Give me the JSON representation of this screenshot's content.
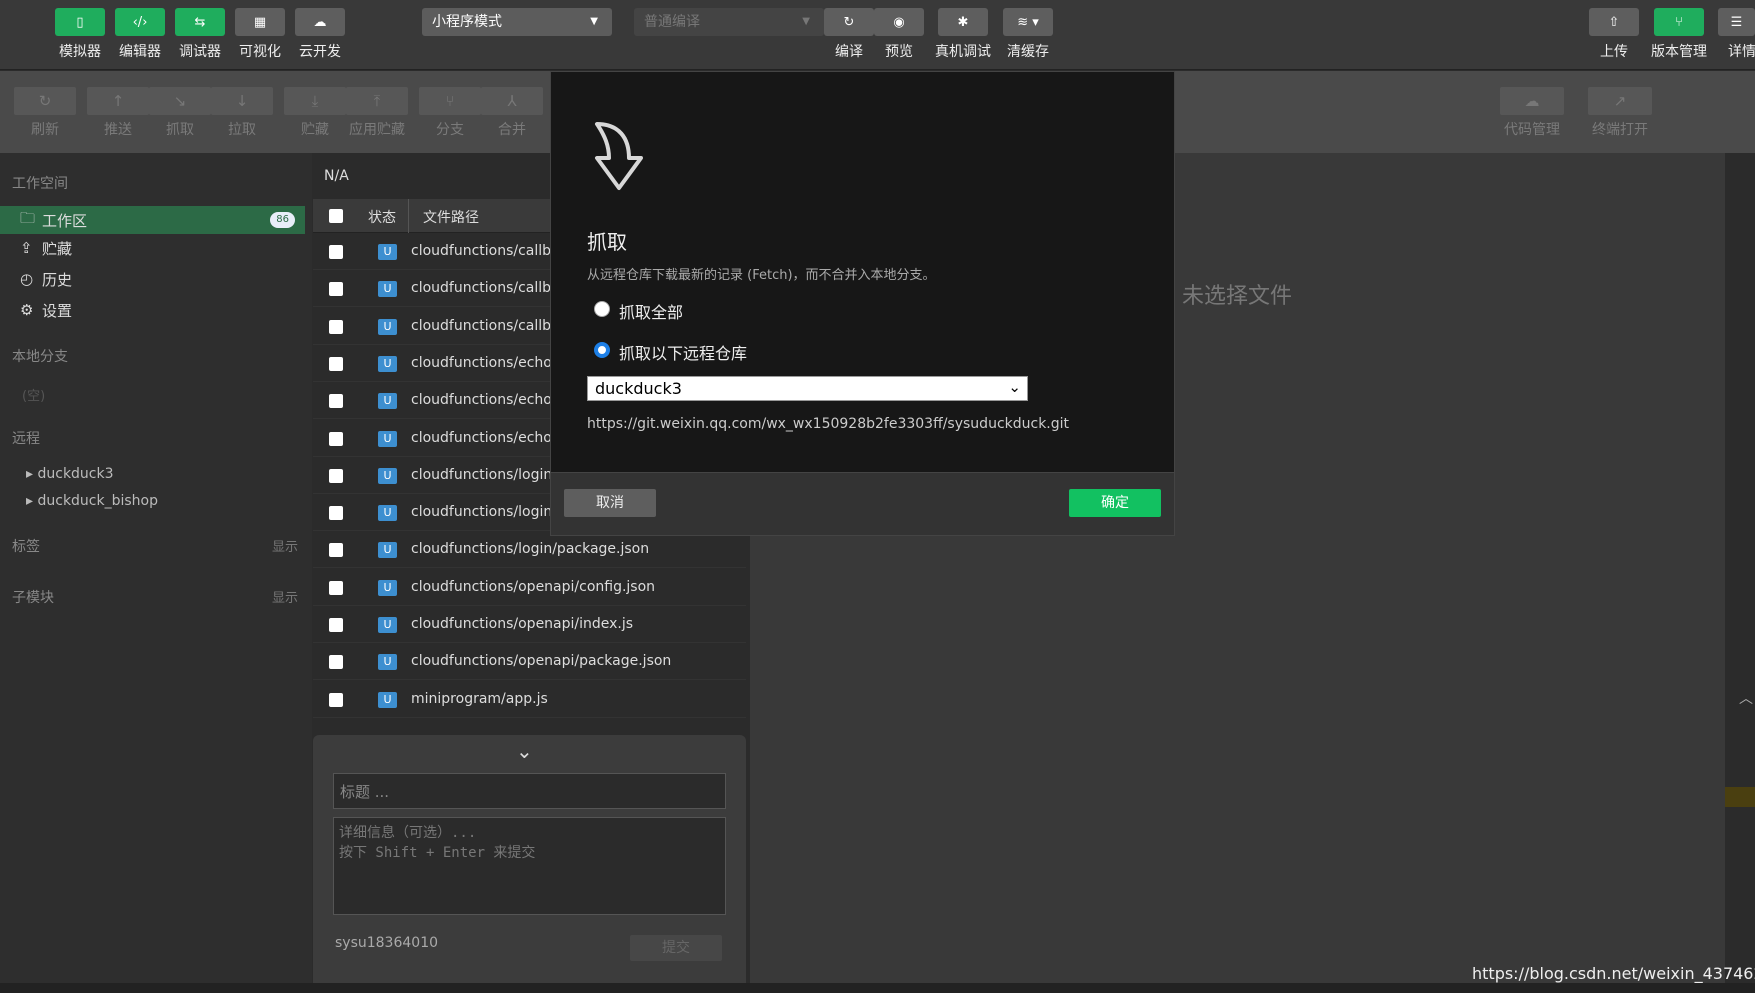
{
  "toolbar": {
    "left_buttons": [
      {
        "label": "模拟器",
        "icon": "phone-icon"
      },
      {
        "label": "编辑器",
        "icon": "code-icon"
      },
      {
        "label": "调试器",
        "icon": "toggle-icon"
      },
      {
        "label": "可视化",
        "icon": "layout-icon"
      },
      {
        "label": "云开发",
        "icon": "cloud-icon"
      }
    ],
    "mode_select": "小程序模式",
    "compile_select": "普通编译",
    "right_buttons": [
      {
        "label": "编译",
        "icon": "refresh-icon"
      },
      {
        "label": "预览",
        "icon": "eye-icon"
      },
      {
        "label": "真机调试",
        "icon": "bug-icon"
      },
      {
        "label": "清缓存",
        "icon": "layers-icon"
      }
    ],
    "far_right": [
      {
        "label": "上传",
        "icon": "upload-icon"
      },
      {
        "label": "版本管理",
        "icon": "branch-icon"
      },
      {
        "label": "详情",
        "icon": "menu-icon"
      }
    ]
  },
  "git_toolbar": {
    "buttons": [
      "刷新",
      "推送",
      "抓取",
      "拉取",
      "贮藏",
      "应用贮藏",
      "分支",
      "合并"
    ],
    "right_buttons": [
      "代码管理",
      "终端打开"
    ]
  },
  "sidebar": {
    "workspace_title": "工作空间",
    "items": [
      {
        "label": "工作区",
        "badge": "86"
      },
      {
        "label": "贮藏"
      },
      {
        "label": "历史"
      },
      {
        "label": "设置"
      }
    ],
    "local_branch_title": "本地分支",
    "local_branch_empty": "(空)",
    "remote_title": "远程",
    "remotes": [
      "duckduck3",
      "duckduck_bishop"
    ],
    "tags_title": "标签",
    "tags_show": "显示",
    "submodule_title": "子模块",
    "submodule_show": "显示"
  },
  "files": {
    "header": "N/A",
    "col_status": "状态",
    "col_path": "文件路径",
    "rows": [
      {
        "status": "U",
        "path": "cloudfunctions/callba"
      },
      {
        "status": "U",
        "path": "cloudfunctions/callba"
      },
      {
        "status": "U",
        "path": "cloudfunctions/callba"
      },
      {
        "status": "U",
        "path": "cloudfunctions/echo/"
      },
      {
        "status": "U",
        "path": "cloudfunctions/echo/"
      },
      {
        "status": "U",
        "path": "cloudfunctions/echo/"
      },
      {
        "status": "U",
        "path": "cloudfunctions/login/"
      },
      {
        "status": "U",
        "path": "cloudfunctions/login/"
      },
      {
        "status": "U",
        "path": "cloudfunctions/login/package.json"
      },
      {
        "status": "U",
        "path": "cloudfunctions/openapi/config.json"
      },
      {
        "status": "U",
        "path": "cloudfunctions/openapi/index.js"
      },
      {
        "status": "U",
        "path": "cloudfunctions/openapi/package.json"
      },
      {
        "status": "U",
        "path": "miniprogram/app.js"
      }
    ]
  },
  "commit": {
    "title_placeholder": "标题 ...",
    "detail_placeholder_line1": "详细信息（可选）...",
    "detail_placeholder_line2": "按下 Shift + Enter 来提交",
    "user": "sysu18364010",
    "submit": "提交"
  },
  "main": {
    "empty_text": "未选择文件"
  },
  "dialog": {
    "title": "抓取",
    "description": "从远程仓库下载最新的记录 (Fetch)，而不合并入本地分支。",
    "option_all": "抓取全部",
    "option_remote": "抓取以下远程仓库",
    "selected_option": "option_remote",
    "remote_select": "duckduck3",
    "remote_url": "https://git.weixin.qq.com/wx_wx150928b2fe3303ff/sysuduckduck.git",
    "cancel": "取消",
    "confirm": "确定"
  },
  "watermark": "https://blog.csdn.net/weixin_43746266",
  "colors": {
    "accent_green": "#1fad5d",
    "active_item": "#2c6a46",
    "badge_blue": "#3d8fd0",
    "radio_blue": "#1d7fe6"
  }
}
